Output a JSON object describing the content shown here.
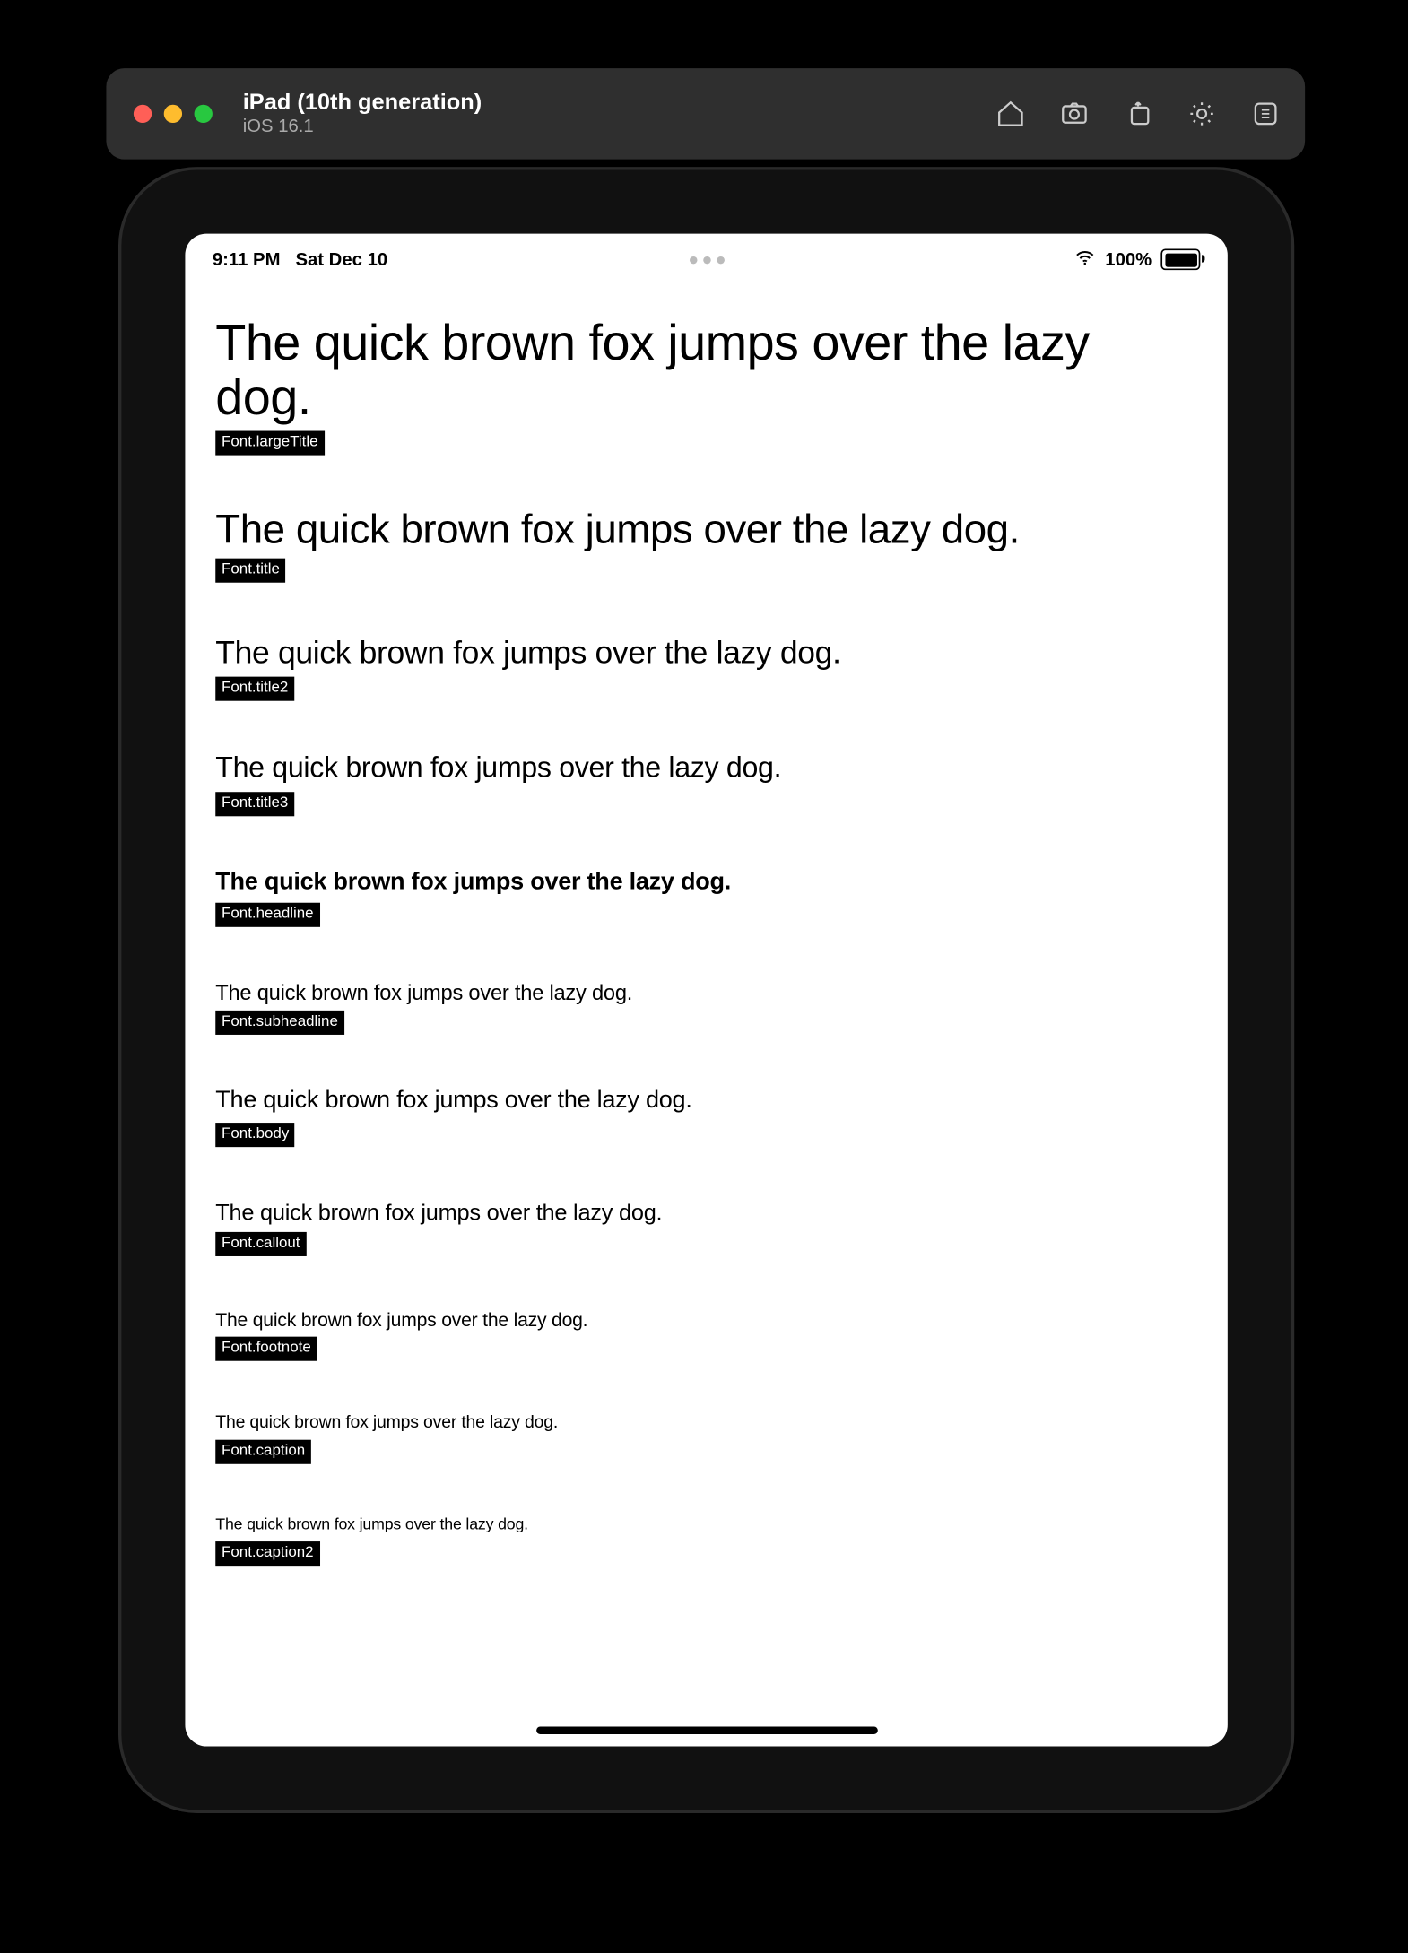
{
  "simulator": {
    "title": "iPad (10th generation)",
    "subtitle": "iOS 16.1",
    "icons": [
      "home-icon",
      "screenshot-icon",
      "rotate-icon",
      "brightness-icon",
      "keyboard-shortcuts-icon"
    ]
  },
  "status_bar": {
    "time": "9:11 PM",
    "date": "Sat Dec 10",
    "battery_percent": "100%"
  },
  "pangram": "The quick brown fox jumps over the lazy dog.",
  "fonts": [
    {
      "class": "f-largeTitle",
      "label": "Font.largeTitle"
    },
    {
      "class": "f-title",
      "label": "Font.title"
    },
    {
      "class": "f-title2",
      "label": "Font.title2"
    },
    {
      "class": "f-title3",
      "label": "Font.title3"
    },
    {
      "class": "f-headline",
      "label": "Font.headline"
    },
    {
      "class": "f-subheadline",
      "label": "Font.subheadline"
    },
    {
      "class": "f-body",
      "label": "Font.body"
    },
    {
      "class": "f-callout",
      "label": "Font.callout"
    },
    {
      "class": "f-footnote",
      "label": "Font.footnote"
    },
    {
      "class": "f-caption",
      "label": "Font.caption"
    },
    {
      "class": "f-caption2",
      "label": "Font.caption2"
    }
  ]
}
